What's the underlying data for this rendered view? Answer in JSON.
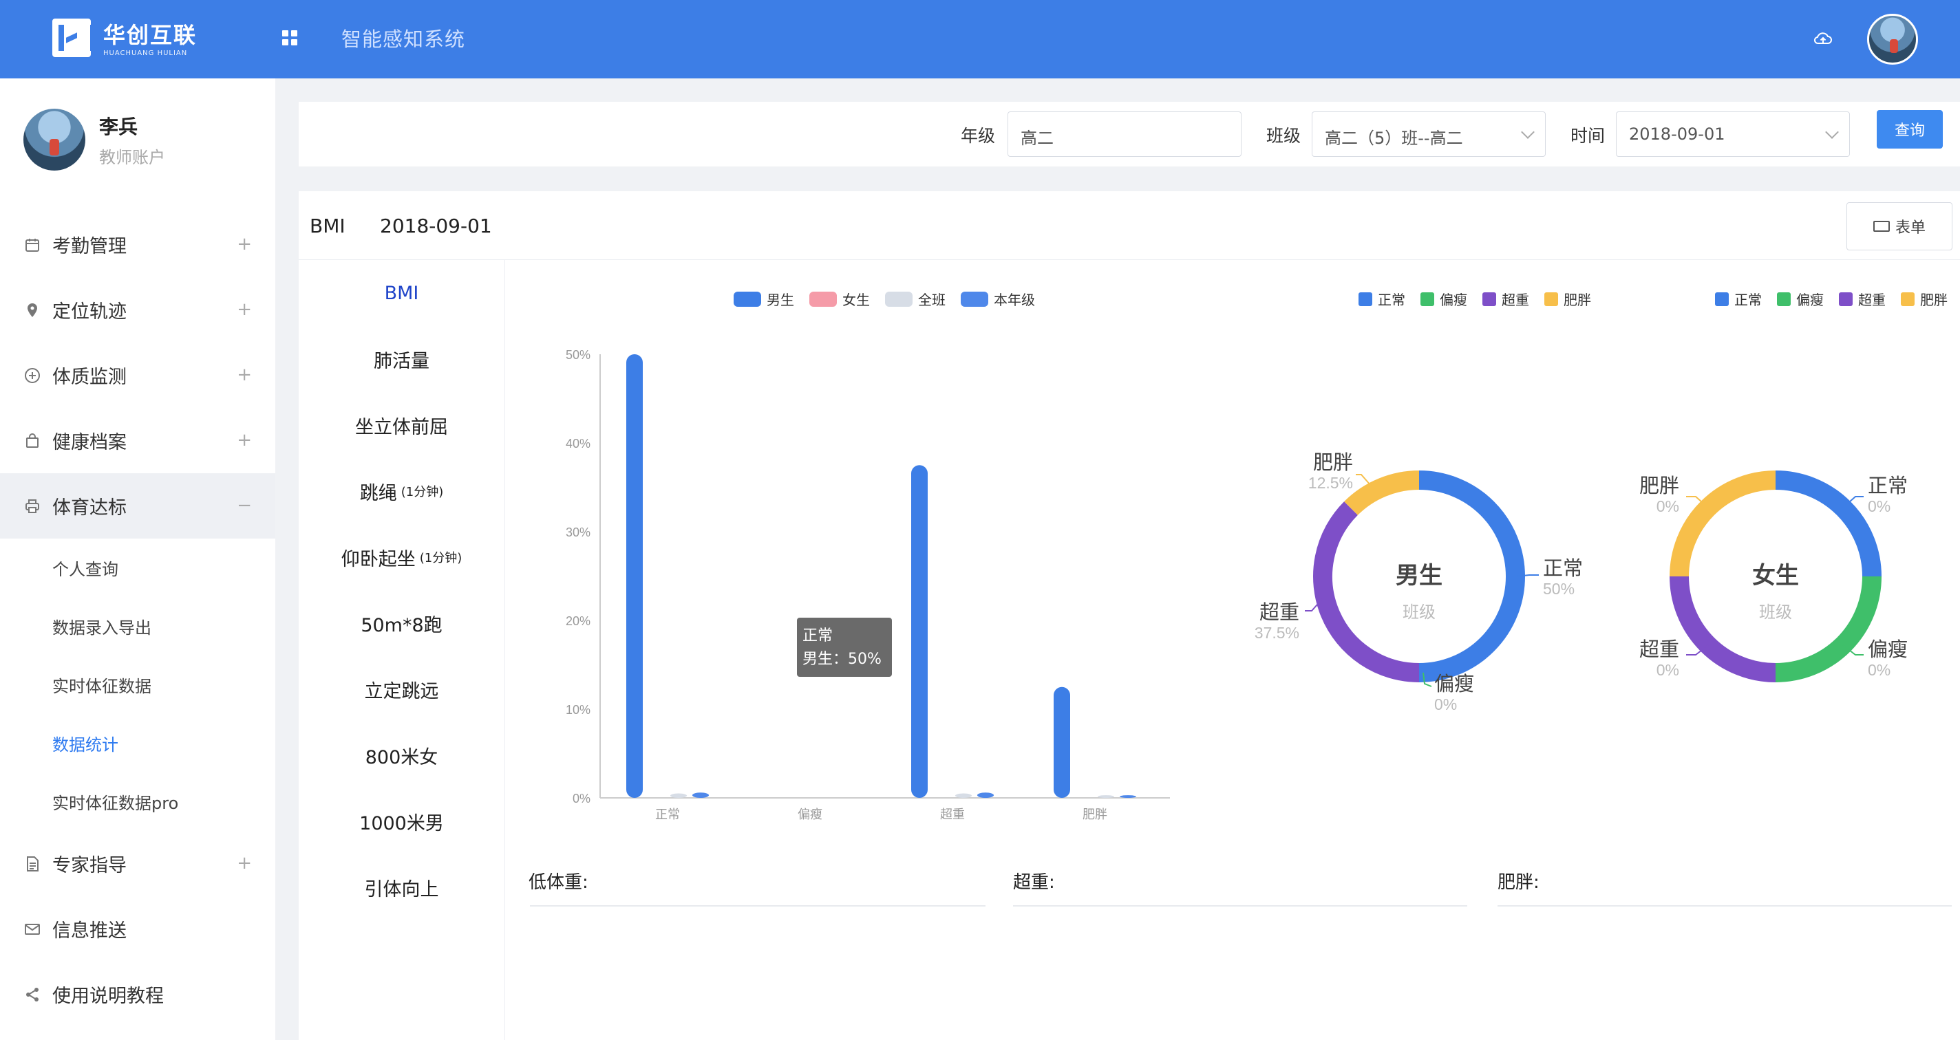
{
  "header": {
    "brand_cn": "华创互联",
    "brand_en": "HUACHUANG HULIAN",
    "system_title": "智能感知系统"
  },
  "user": {
    "name": "李兵",
    "role": "教师账户"
  },
  "sidebar": {
    "items": [
      {
        "label": "考勤管理",
        "icon": "calendar-icon",
        "toggle": "+"
      },
      {
        "label": "定位轨迹",
        "icon": "location-pin-icon",
        "toggle": "+"
      },
      {
        "label": "体质监测",
        "icon": "plus-circle-icon",
        "toggle": "+"
      },
      {
        "label": "健康档案",
        "icon": "bag-icon",
        "toggle": "+"
      },
      {
        "label": "体育达标",
        "icon": "printer-icon",
        "toggle": "−"
      }
    ],
    "subitems": [
      "个人查询",
      "数据录入导出",
      "实时体征数据",
      "数据统计",
      "实时体征数据pro"
    ],
    "items_after": [
      {
        "label": "专家指导",
        "icon": "document-icon",
        "toggle": "+"
      },
      {
        "label": "信息推送",
        "icon": "mail-icon",
        "toggle": ""
      },
      {
        "label": "使用说明教程",
        "icon": "share-icon",
        "toggle": ""
      }
    ]
  },
  "filters": {
    "grade_label": "年级",
    "grade_value": "高二",
    "class_label": "班级",
    "class_value": "高二（5）班--高二",
    "time_label": "时间",
    "time_value": "2018-09-01",
    "query_button": "查询"
  },
  "panel": {
    "metric_name": "BMI",
    "date": "2018-09-01",
    "form_button": "表单"
  },
  "metrics": [
    {
      "label": "BMI",
      "small": ""
    },
    {
      "label": "肺活量",
      "small": ""
    },
    {
      "label": "坐立体前屈",
      "small": ""
    },
    {
      "label": "跳绳",
      "small": "(1分钟)"
    },
    {
      "label": "仰卧起坐",
      "small": "(1分钟)"
    },
    {
      "label": "50m*8跑",
      "small": ""
    },
    {
      "label": "立定跳远",
      "small": ""
    },
    {
      "label": "800米女",
      "small": ""
    },
    {
      "label": "1000米男",
      "small": ""
    },
    {
      "label": "引体向上",
      "small": ""
    }
  ],
  "colors": {
    "male": "#3d7ee6",
    "female": "#f59ba8",
    "whole_class": "#d7dde6",
    "grade": "#4f88ea",
    "normal": "#3d7ee6",
    "thin": "#3fbf6a",
    "overweight": "#7e4fc8",
    "obese": "#f7bf4a"
  },
  "tooltip": {
    "category": "正常",
    "text": "男生：50%"
  },
  "bottom": {
    "underweight": "低体重:",
    "overweight": "超重:",
    "obese": "肥胖:"
  },
  "chart_data": [
    {
      "type": "bar",
      "categories": [
        "正常",
        "偏瘦",
        "超重",
        "肥胖"
      ],
      "ylim": [
        0,
        50
      ],
      "yticks": [
        "0%",
        "10%",
        "20%",
        "30%",
        "40%",
        "50%"
      ],
      "series": [
        {
          "name": "男生",
          "values": [
            50,
            0,
            37.5,
            12.5
          ]
        },
        {
          "name": "女生",
          "values": [
            0,
            0,
            0,
            0
          ]
        },
        {
          "name": "全班",
          "values": [
            0.5,
            0,
            0.5,
            0.3
          ]
        },
        {
          "name": "本年级",
          "values": [
            0.6,
            0,
            0.6,
            0.3
          ]
        }
      ]
    },
    {
      "type": "pie",
      "title": "男生",
      "subtitle": "班级",
      "legend": [
        "正常",
        "偏瘦",
        "超重",
        "肥胖"
      ],
      "slices": [
        {
          "name": "正常",
          "value": 50,
          "label": "50%"
        },
        {
          "name": "偏瘦",
          "value": 0,
          "label": "0%"
        },
        {
          "name": "超重",
          "value": 37.5,
          "label": "37.5%"
        },
        {
          "name": "肥胖",
          "value": 12.5,
          "label": "12.5%"
        }
      ]
    },
    {
      "type": "pie",
      "title": "女生",
      "subtitle": "班级",
      "legend": [
        "正常",
        "偏瘦",
        "超重",
        "肥胖"
      ],
      "slices": [
        {
          "name": "正常",
          "value": 25,
          "label": "0%"
        },
        {
          "name": "偏瘦",
          "value": 25,
          "label": "0%"
        },
        {
          "name": "超重",
          "value": 25,
          "label": "0%"
        },
        {
          "name": "肥胖",
          "value": 25,
          "label": "0%"
        }
      ]
    }
  ]
}
